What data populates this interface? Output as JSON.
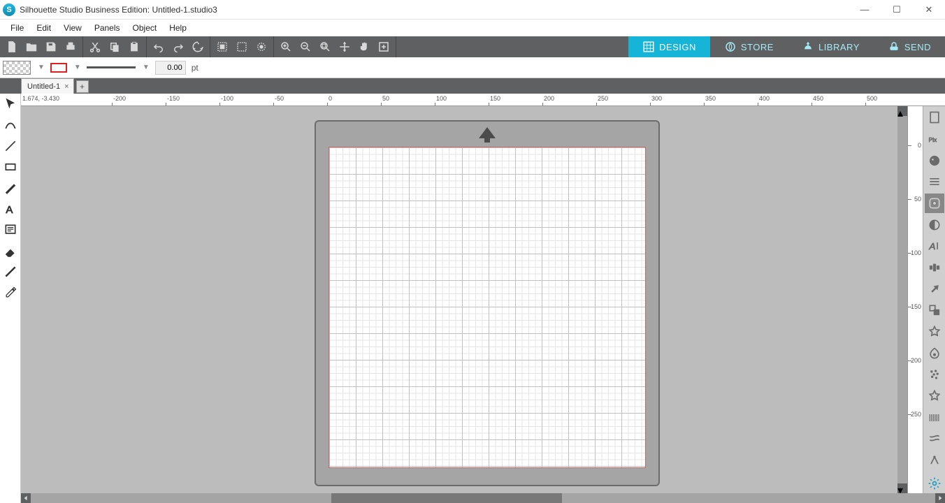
{
  "title": "Silhouette Studio Business Edition: Untitled-1.studio3",
  "menu": [
    "File",
    "Edit",
    "View",
    "Panels",
    "Object",
    "Help"
  ],
  "modes": {
    "design": "DESIGN",
    "store": "STORE",
    "library": "LIBRARY",
    "send": "SEND"
  },
  "pt_value": "0.00",
  "pt_unit": "pt",
  "tab_name": "Untitled-1",
  "coord": "1.674, -3.430",
  "hruler": [
    -200,
    -150,
    -100,
    -50,
    0,
    50,
    100,
    150,
    200,
    250,
    300,
    350,
    400,
    450,
    500
  ],
  "vruler": [
    0,
    50,
    100,
    150,
    200,
    250
  ]
}
